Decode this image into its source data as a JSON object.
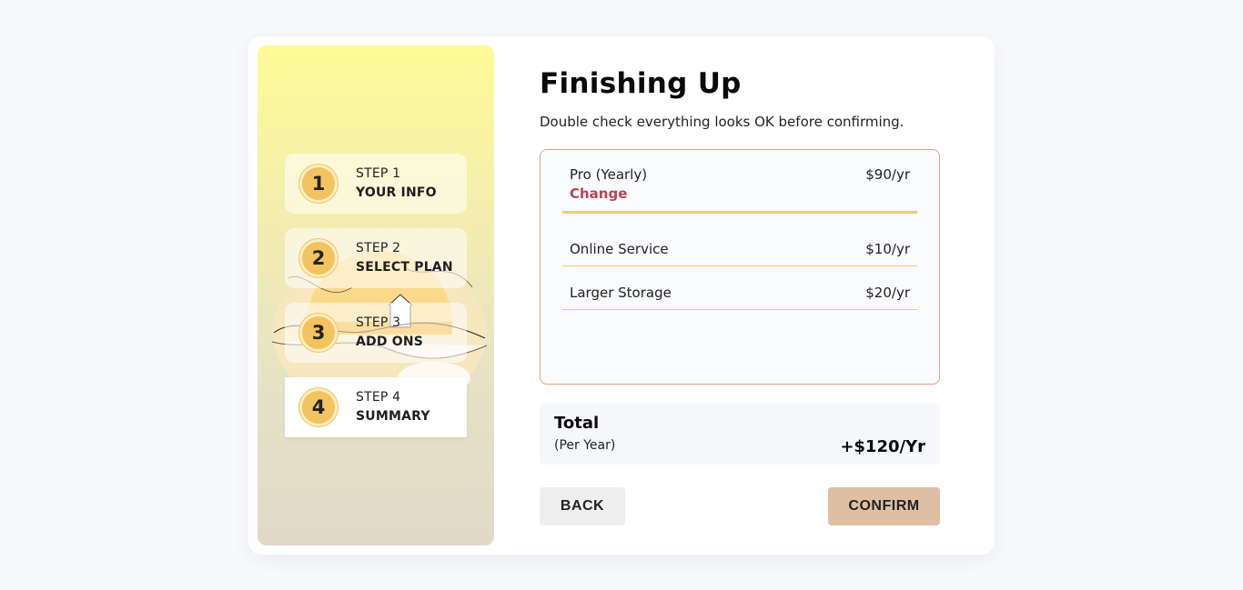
{
  "sidebar": {
    "steps": [
      {
        "number": "1",
        "label": "STEP 1",
        "title": "YOUR INFO"
      },
      {
        "number": "2",
        "label": "STEP 2",
        "title": "SELECT PLAN"
      },
      {
        "number": "3",
        "label": "STEP 3",
        "title": "ADD ONS"
      },
      {
        "number": "4",
        "label": "STEP 4",
        "title": "SUMMARY"
      }
    ],
    "active_step": "4"
  },
  "main": {
    "title": "Finishing Up",
    "subtitle": "Double check everything looks OK before confirming.",
    "plan": {
      "name": "Pro (Yearly)",
      "price": "$90/yr",
      "change_label": "Change"
    },
    "addons": [
      {
        "name": "Online Service",
        "price": "$10/yr"
      },
      {
        "name": "Larger Storage",
        "price": "$20/yr"
      }
    ],
    "total": {
      "label": "Total",
      "period": "(Per Year)",
      "amount": "+$120/Yr"
    },
    "buttons": {
      "back": "BACK",
      "confirm": "CONFIRM"
    }
  },
  "colors": {
    "accent": "#f2c35e",
    "change_link": "#b84452",
    "confirm_button": "#dfbfa3",
    "summary_border": "#e3a083"
  }
}
